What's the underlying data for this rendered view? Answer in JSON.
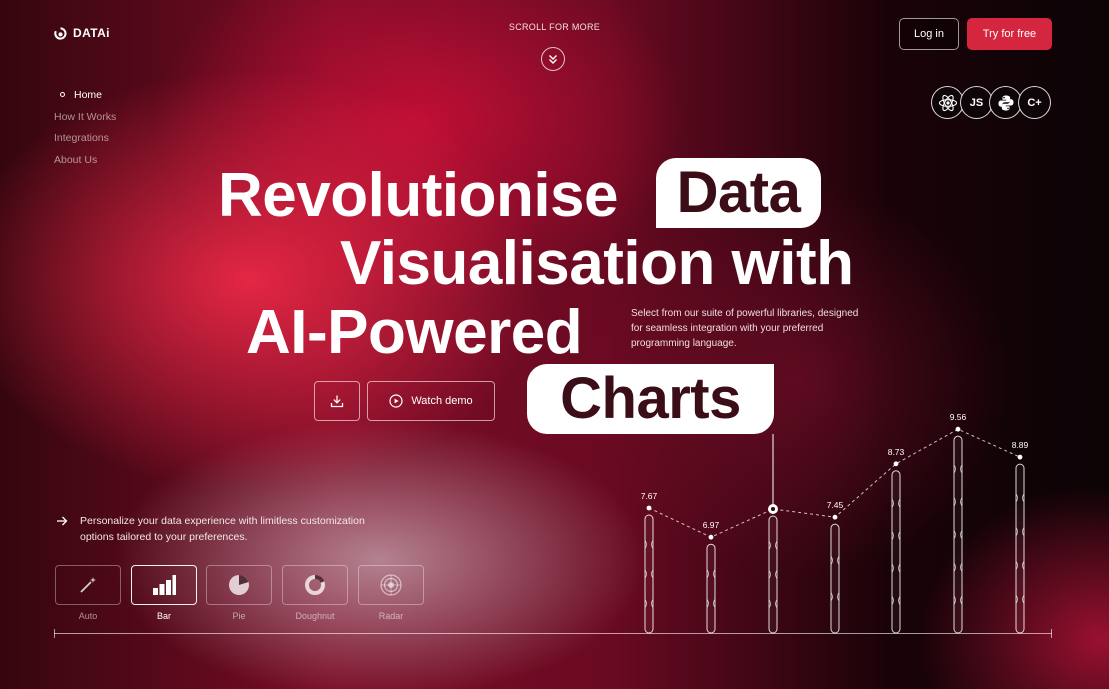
{
  "brand": {
    "name": "DATAi"
  },
  "header": {
    "scroll_label": "SCROLL FOR MORE",
    "login_label": "Log in",
    "try_label": "Try for free",
    "accent_color": "#d5263f"
  },
  "nav": {
    "items": [
      {
        "label": "Home",
        "active": true
      },
      {
        "label": "How It Works",
        "active": false
      },
      {
        "label": "Integrations",
        "active": false
      },
      {
        "label": "About Us",
        "active": false
      }
    ]
  },
  "languages": [
    {
      "icon": "react-icon"
    },
    {
      "icon": "javascript-icon",
      "text": "JS"
    },
    {
      "icon": "python-icon"
    },
    {
      "icon": "cpp-icon",
      "text": "C+"
    }
  ],
  "hero": {
    "line1": "Revolutionise",
    "line1_pill": "Data",
    "line2": "Visualisation with",
    "line3": "AI-Powered",
    "line4_pill": "Charts",
    "subtext": "Select from our suite of powerful libraries, designed for seamless integration with your preferred programming language.",
    "download_icon": "download-icon",
    "demo_label": "Watch demo"
  },
  "personalize": {
    "text": "Personalize your data experience with limitless customization options tailored to your preferences."
  },
  "chart_types": [
    {
      "label": "Auto",
      "icon": "magic-wand-icon",
      "active": false
    },
    {
      "label": "Bar",
      "icon": "bar-chart-icon",
      "active": true
    },
    {
      "label": "Pie",
      "icon": "pie-chart-icon",
      "active": false
    },
    {
      "label": "Doughnut",
      "icon": "doughnut-chart-icon",
      "active": false
    },
    {
      "label": "Radar",
      "icon": "radar-chart-icon",
      "active": false
    }
  ],
  "chart_data": {
    "type": "bar",
    "values": [
      7.67,
      6.97,
      null,
      7.45,
      8.73,
      9.56,
      8.89
    ],
    "value_labels": [
      "7.67",
      "6.97",
      "",
      "7.45",
      "8.73",
      "9.56",
      "8.89"
    ],
    "highlighted_index": 2,
    "ylim": [
      0,
      10
    ],
    "grid": false
  }
}
